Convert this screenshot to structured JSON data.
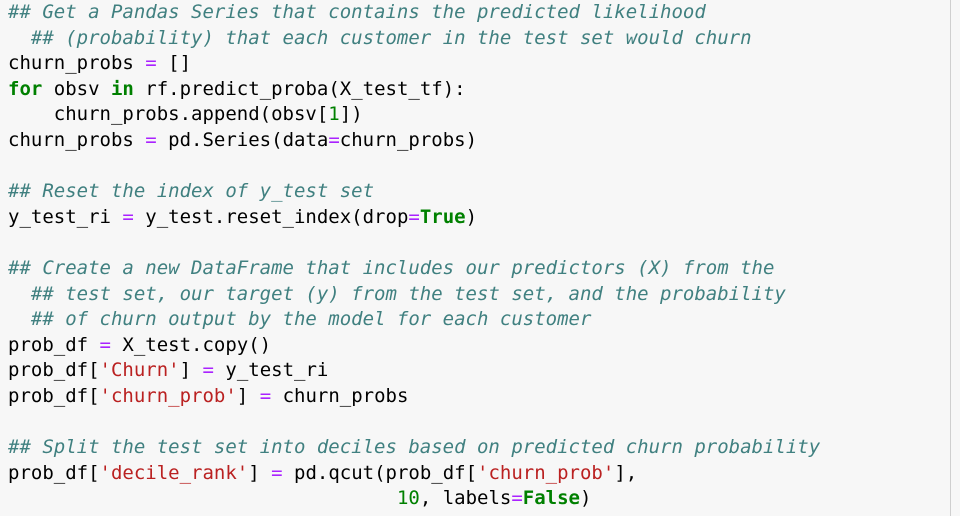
{
  "code_cell": {
    "lines": [
      [
        {
          "t": "## Get a Pandas Series that contains the predicted likelihood",
          "c": "cm"
        }
      ],
      [
        {
          "t": "  ## (probability) that each customer in the test set would churn",
          "c": "cm"
        }
      ],
      [
        {
          "t": "churn_probs ",
          "c": ""
        },
        {
          "t": "=",
          "c": "op"
        },
        {
          "t": " []",
          "c": ""
        }
      ],
      [
        {
          "t": "for",
          "c": "kw"
        },
        {
          "t": " obsv ",
          "c": ""
        },
        {
          "t": "in",
          "c": "kw"
        },
        {
          "t": " rf.predict_proba(X_test_tf):",
          "c": ""
        }
      ],
      [
        {
          "t": "    churn_probs.append(obsv[",
          "c": ""
        },
        {
          "t": "1",
          "c": "nm"
        },
        {
          "t": "])",
          "c": ""
        }
      ],
      [
        {
          "t": "churn_probs ",
          "c": ""
        },
        {
          "t": "=",
          "c": "op"
        },
        {
          "t": " pd.Series(data",
          "c": ""
        },
        {
          "t": "=",
          "c": "op"
        },
        {
          "t": "churn_probs)",
          "c": ""
        }
      ],
      [],
      [
        {
          "t": "## Reset the index of y_test set",
          "c": "cm"
        }
      ],
      [
        {
          "t": "y_test_ri ",
          "c": ""
        },
        {
          "t": "=",
          "c": "op"
        },
        {
          "t": " y_test.reset_index(drop",
          "c": ""
        },
        {
          "t": "=",
          "c": "op"
        },
        {
          "t": "True",
          "c": "kw"
        },
        {
          "t": ")",
          "c": ""
        }
      ],
      [],
      [
        {
          "t": "## Create a new DataFrame that includes our predictors (X) from the",
          "c": "cm"
        }
      ],
      [
        {
          "t": "  ## test set, our target (y) from the test set, and the probability",
          "c": "cm"
        }
      ],
      [
        {
          "t": "  ## of churn output by the model for each customer",
          "c": "cm"
        }
      ],
      [
        {
          "t": "prob_df ",
          "c": ""
        },
        {
          "t": "=",
          "c": "op"
        },
        {
          "t": " X_test.copy()",
          "c": ""
        }
      ],
      [
        {
          "t": "prob_df[",
          "c": ""
        },
        {
          "t": "'Churn'",
          "c": "st"
        },
        {
          "t": "] ",
          "c": ""
        },
        {
          "t": "=",
          "c": "op"
        },
        {
          "t": " y_test_ri",
          "c": ""
        }
      ],
      [
        {
          "t": "prob_df[",
          "c": ""
        },
        {
          "t": "'churn_prob'",
          "c": "st"
        },
        {
          "t": "] ",
          "c": ""
        },
        {
          "t": "=",
          "c": "op"
        },
        {
          "t": " churn_probs",
          "c": ""
        }
      ],
      [],
      [
        {
          "t": "## Split the test set into deciles based on predicted churn probability",
          "c": "cm"
        }
      ],
      [
        {
          "t": "prob_df[",
          "c": ""
        },
        {
          "t": "'decile_rank'",
          "c": "st"
        },
        {
          "t": "] ",
          "c": ""
        },
        {
          "t": "=",
          "c": "op"
        },
        {
          "t": " pd.qcut(prob_df[",
          "c": ""
        },
        {
          "t": "'churn_prob'",
          "c": "st"
        },
        {
          "t": "],",
          "c": ""
        }
      ],
      [
        {
          "t": "                                  ",
          "c": ""
        },
        {
          "t": "10",
          "c": "nm"
        },
        {
          "t": ", labels",
          "c": ""
        },
        {
          "t": "=",
          "c": "op"
        },
        {
          "t": "False",
          "c": "kw"
        },
        {
          "t": ")",
          "c": ""
        }
      ]
    ]
  }
}
